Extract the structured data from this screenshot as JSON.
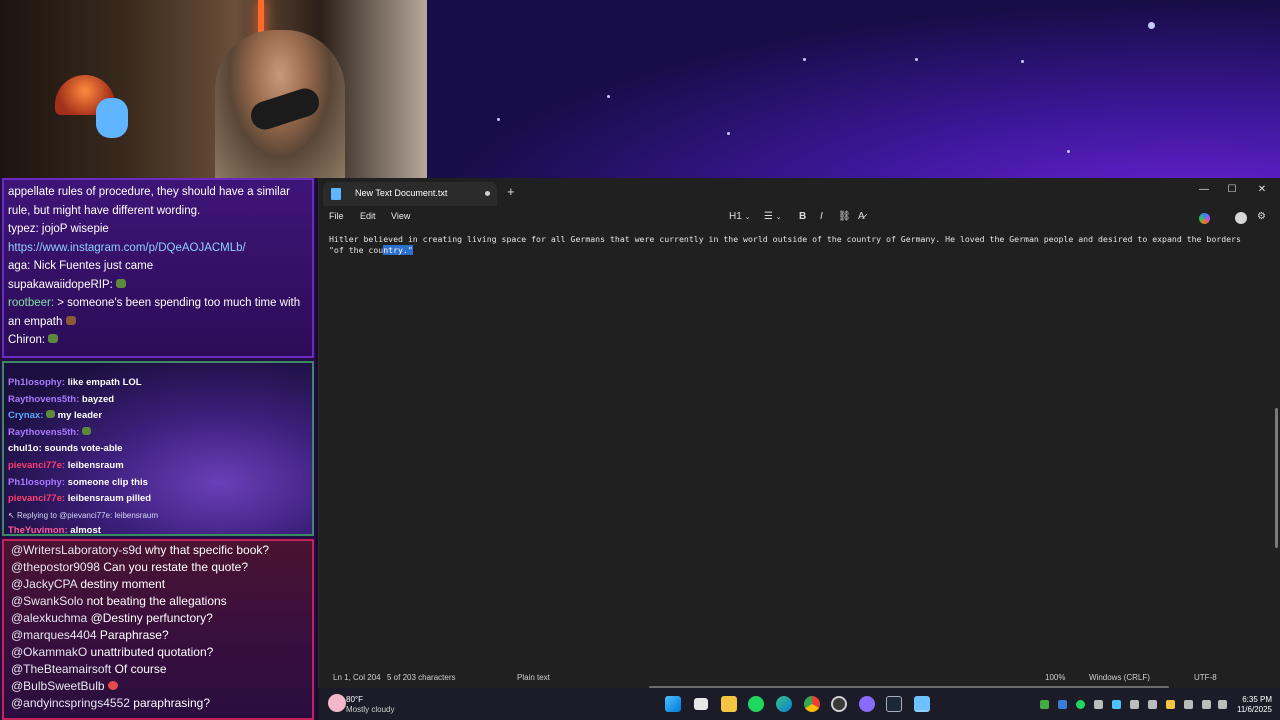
{
  "chat_top": {
    "lines": [
      {
        "user": "",
        "text": "appellate rules of procedure, they should have a similar"
      },
      {
        "user": "",
        "text": "rule, but might have different wording."
      },
      {
        "user": "typez:",
        "text": "jojoP wisepie"
      },
      {
        "user": "",
        "text": "https://www.instagram.com/p/DQeAOJACMLb/"
      },
      {
        "user": "aga:",
        "text": "Nick Fuentes just came"
      },
      {
        "user": "supakawaiidopeRIP:",
        "text": ""
      },
      {
        "user": "rootbeer:",
        "text": "> someone's been spending too much time with"
      },
      {
        "user": "",
        "text": "an empath"
      },
      {
        "user": "Chiron:",
        "text": ""
      }
    ]
  },
  "chat_mid": {
    "lines": [
      {
        "user": "Ph1losophy:",
        "text": "like empath LOL",
        "color": "purple"
      },
      {
        "user": "Raythovens5th:",
        "text": "bayzed",
        "color": "purple"
      },
      {
        "user": "Crynax:",
        "text": "my leader",
        "color": "blue"
      },
      {
        "user": "Raythovens5th:",
        "text": "",
        "color": "purple"
      },
      {
        "user": "chul1o:",
        "text": "sounds vote-able",
        "color": "white"
      },
      {
        "user": "pievanci77e:",
        "text": "leibensraum",
        "color": "red"
      },
      {
        "user": "Ph1losophy:",
        "text": "someone clip this",
        "color": "purple"
      },
      {
        "user": "pievanci77e:",
        "text": "leibensraum pilled",
        "color": "red"
      }
    ],
    "reply_note": "Replying to @pievanci77e: leibensraum",
    "last": {
      "user": "TheYuvimon:",
      "text": "almost"
    }
  },
  "chat_bottom": {
    "lines": [
      {
        "user": "@WritersLaboratory-s9d",
        "text": "why that specific book?"
      },
      {
        "user": "@thepostor9098",
        "text": "Can you restate the quote?"
      },
      {
        "user": "@JackyCPA",
        "text": "destiny moment"
      },
      {
        "user": "@SwankSolo",
        "text": "not beating the allegations"
      },
      {
        "user": "@alexkuchma",
        "text": "@Destiny perfunctory?"
      },
      {
        "user": "@marques4404",
        "text": "Paraphrase?"
      },
      {
        "user": "@OkammakO",
        "text": "unattributed quotation?"
      },
      {
        "user": "@TheBteamairsoft",
        "text": "Of course"
      },
      {
        "user": "@BulbSweetBulb",
        "text": ""
      },
      {
        "user": "@andyincsprings4552",
        "text": "paraphrasing?"
      }
    ]
  },
  "notepad": {
    "tab_title": "New Text Document.txt",
    "new_tab": "+",
    "menu": {
      "file": "File",
      "edit": "Edit",
      "view": "View"
    },
    "toolbar": {
      "heading": "H1",
      "bold": "B",
      "italic": "I"
    },
    "content": {
      "before": "Hitler believed in creating living space for all Germans that were currently in the world outside of the country of Germany. He loved the German people and desired to expand the borders\n\"of the cou",
      "selected": "ntry.\""
    },
    "status": {
      "position": "Ln 1, Col 204",
      "chars": "5 of 203 characters",
      "format": "Plain text",
      "zoom": "100%",
      "line_ending": "Windows (CRLF)",
      "encoding": "UTF-8"
    }
  },
  "taskbar": {
    "temp": "80°F",
    "condition": "Mostly cloudy",
    "time": "6:35 PM",
    "date": "11/6/2025"
  }
}
